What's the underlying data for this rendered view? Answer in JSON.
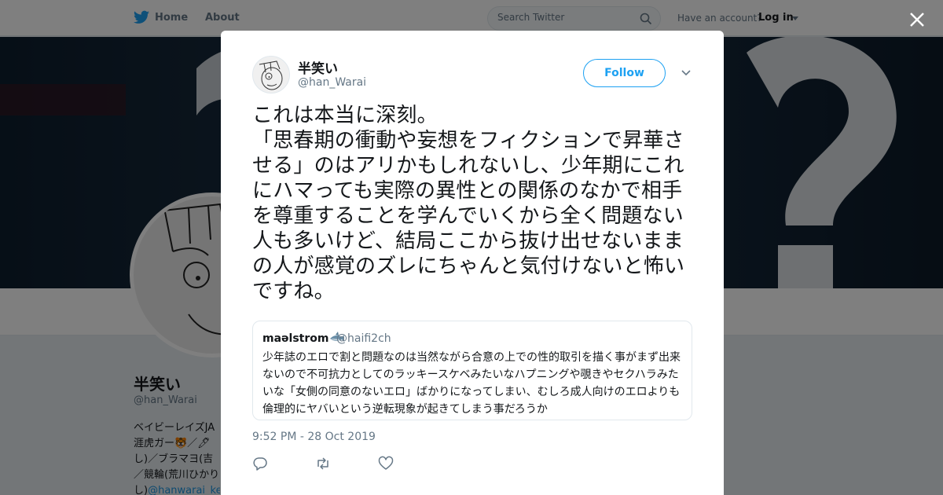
{
  "topbar": {
    "home_label": "Home",
    "about_label": "About",
    "search_placeholder": "Search Twitter",
    "have_account": "Have an account?",
    "login_label": "Log in"
  },
  "profile": {
    "name": "半笑い",
    "handle": "@han_Warai",
    "bio_lines": [
      "ベイビーレイズJA",
      "涯虎ガー🐯／🖊",
      "し)／ブラマヨ(吉",
      "／競輪(荒川ひかり",
      "し)"
    ],
    "bio_link": "@hanwarai_ke"
  },
  "tweet": {
    "author_name": "半笑い",
    "author_handle": "@han_Warai",
    "follow_label": "Follow",
    "text": "これは本当に深刻。\n「思春期の衝動や妄想をフィクションで昇華させる」のはアリかもしれないし、少年期にこれにハマっても実際の異性との関係のなかで相手を尊重することを学んでいくから全く問題ない人も多いけど、結局ここから抜け出せないままの人が感覚のズレにちゃんと気付けないと怖いですね。",
    "timestamp": "9:52 PM - 28 Oct 2019",
    "quoted": {
      "name": "maəlstrom",
      "handle": "@haifi2ch",
      "text": "少年誌のエロで割と問題なのは当然ながら合意の上での性的取引を描く事がまず出来ないので不可抗力としてのラッキースケベみたいなハプニングや覗きやセクハラみたいな「女側の同意のないエロ」ばかりになってしまい、むしろ成人向けのエロよりも倫理的にヤバいという逆転現象が起きてしまう事だろうか"
    },
    "actions": [
      {
        "icon": "reply-icon"
      },
      {
        "icon": "retweet-icon"
      },
      {
        "icon": "like-icon"
      }
    ]
  },
  "colors": {
    "accent": "#1da1f2",
    "secondary_text": "#657786",
    "overlay": "rgba(0,0,0,0.5)"
  }
}
